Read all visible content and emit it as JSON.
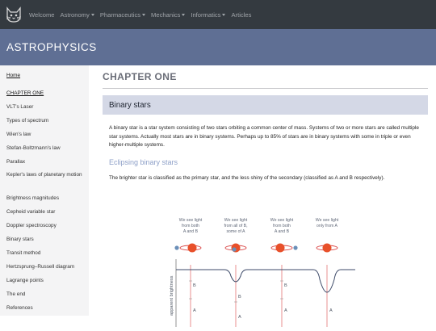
{
  "nav": {
    "items": [
      {
        "label": "Welcome",
        "dropdown": false
      },
      {
        "label": "Astronomy",
        "dropdown": true
      },
      {
        "label": "Pharmaceutics",
        "dropdown": true
      },
      {
        "label": "Mechanics",
        "dropdown": true
      },
      {
        "label": "Informatics",
        "dropdown": true
      },
      {
        "label": "Articles",
        "dropdown": false
      }
    ]
  },
  "banner": {
    "title": "ASTROPHYSICS"
  },
  "sidebar": {
    "items": [
      {
        "label": "Home"
      },
      {
        "label": "CHAPTER ONE"
      },
      {
        "label": "VLT's Laser"
      },
      {
        "label": "Types of spectrum"
      },
      {
        "label": "Wien's law"
      },
      {
        "label": "Stefan-Boltzmann's law"
      },
      {
        "label": "Parallax"
      },
      {
        "label": "Kepler's laws of planetary motion"
      },
      {
        "label": "Brightness magnitudes"
      },
      {
        "label": "Cepheid variable star"
      },
      {
        "label": "Doppler spectroscopy"
      },
      {
        "label": "Binary stars"
      },
      {
        "label": "Transit method"
      },
      {
        "label": "Hertzsprung–Russell diagram"
      },
      {
        "label": "Lagrange points"
      },
      {
        "label": "The end"
      },
      {
        "label": "References"
      }
    ]
  },
  "main": {
    "chapter_title": "CHAPTER ONE",
    "section_title": "Binary stars",
    "paragraph1": "A binary star is a star system consisting of two stars orbiting a common center of mass. Systems of two or more stars are called multiple star systems. Actually most stars are in binary systems. Perhaps up to 85% of stars are in binary systems with some in triple or even higher-multiple systems.",
    "subheading": "Eclipsing binary stars",
    "paragraph2": "The brighter star is classified as the primary star, and the less shiny of the secondary (classified as A and B respectively)."
  },
  "diagram": {
    "captions": [
      [
        "We see light",
        "from both",
        "A and B"
      ],
      [
        "We see light",
        "from all of B,",
        "some of A"
      ],
      [
        "We see light",
        "from both",
        "A and B"
      ],
      [
        "We see light",
        "only from A"
      ]
    ],
    "ylabel": "apparent brightness",
    "markers": [
      "B",
      "A",
      "B",
      "A",
      "B",
      "A",
      "A"
    ]
  },
  "colors": {
    "nav_bg": "#343a40",
    "banner_bg": "#5f6f94",
    "sidebar_bg": "#f4f4f5",
    "section_bg": "#d4d8e6",
    "subheading": "#8ea0c8",
    "star_a": "#e8502a",
    "orbit": "#d94545",
    "star_b": "#6a8fb8"
  }
}
